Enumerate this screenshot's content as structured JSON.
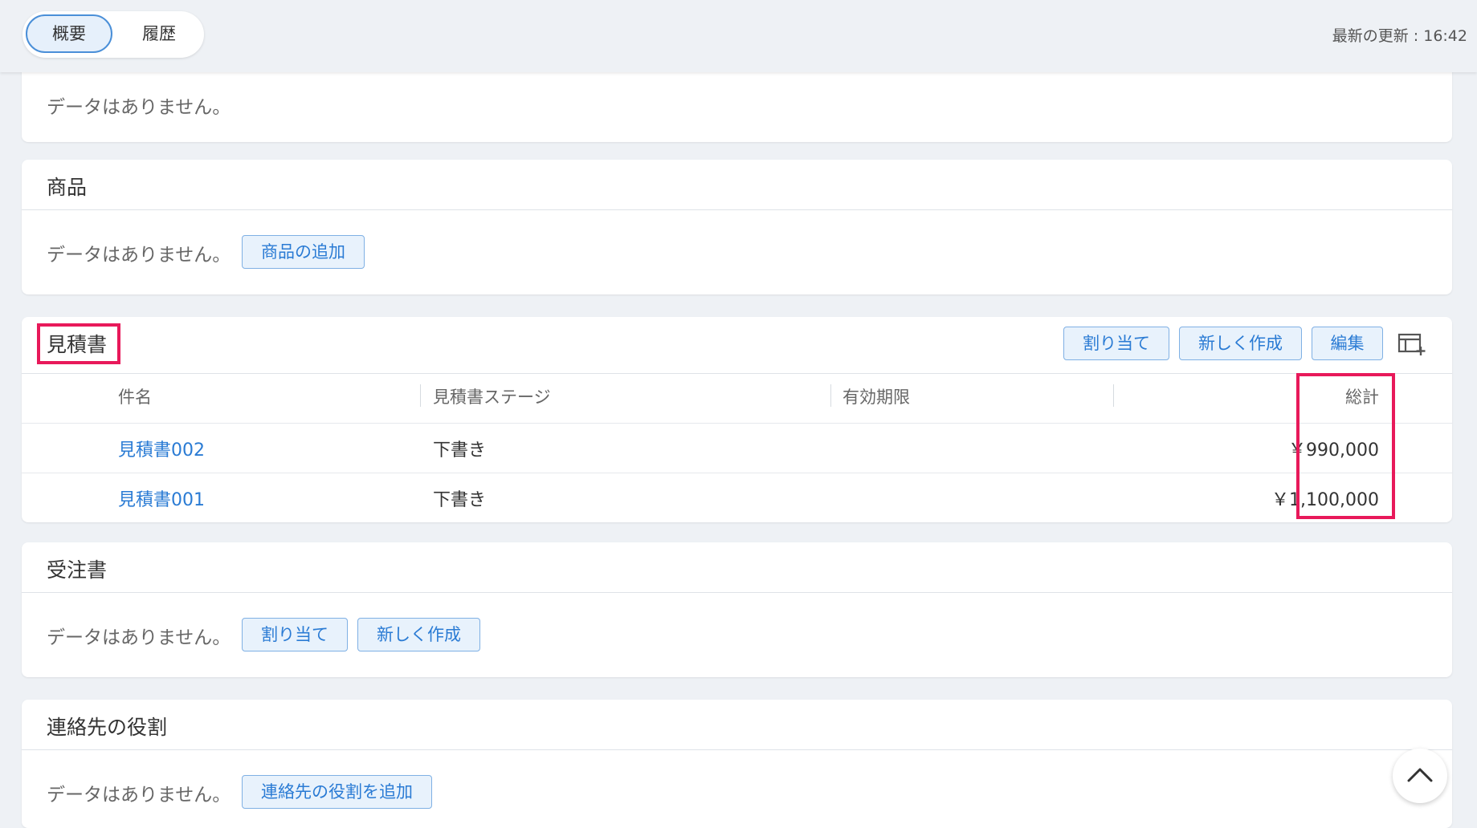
{
  "header": {
    "tabs": [
      {
        "label": "概要",
        "active": true
      },
      {
        "label": "履歴",
        "active": false
      }
    ],
    "last_updated": "最新の更新 : 16:42"
  },
  "top_card": {
    "no_data": "データはありません。"
  },
  "products": {
    "title": "商品",
    "no_data": "データはありません。",
    "add_button": "商品の追加"
  },
  "quotes": {
    "title": "見積書",
    "buttons": {
      "assign": "割り当て",
      "create": "新しく作成",
      "edit": "編集"
    },
    "columns": [
      "件名",
      "見積書ステージ",
      "有効期限",
      "総計"
    ],
    "rows": [
      {
        "name": "見積書002",
        "stage": "下書き",
        "expiry": "",
        "total": "￥990,000"
      },
      {
        "name": "見積書001",
        "stage": "下書き",
        "expiry": "",
        "total": "￥1,100,000"
      }
    ]
  },
  "orders": {
    "title": "受注書",
    "no_data": "データはありません。",
    "buttons": {
      "assign": "割り当て",
      "create": "新しく作成"
    }
  },
  "contact_roles": {
    "title": "連絡先の役割",
    "no_data": "データはありません。",
    "add_button": "連絡先の役割を追加"
  },
  "colors": {
    "accent": "#2a7bd4",
    "highlight": "#e8195a",
    "background": "#eef1f5"
  }
}
